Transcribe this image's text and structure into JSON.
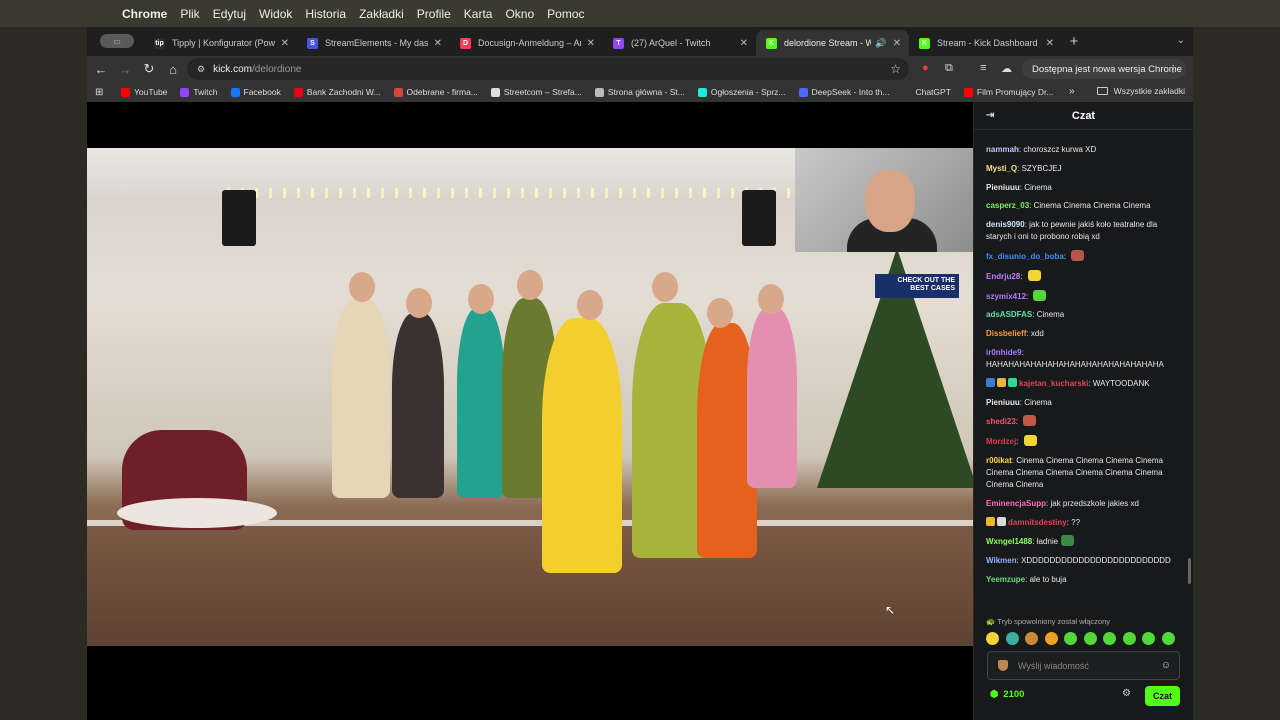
{
  "menubar": {
    "apple_icon": "apple-icon",
    "app": "Chrome",
    "items": [
      "Plik",
      "Edytuj",
      "Widok",
      "Historia",
      "Zakładki",
      "Profile",
      "Karta",
      "Okno",
      "Pomoc"
    ]
  },
  "tabs": [
    {
      "title": "Tipply | Konfigurator (Powiad",
      "active": false,
      "color": "#2a2a2a",
      "glyph": "tip"
    },
    {
      "title": "StreamElements - My dashbo",
      "active": false,
      "color": "#4a56e2",
      "glyph": "S"
    },
    {
      "title": "Docusign-Anmeldung – Anm",
      "active": false,
      "color": "#ff3b57",
      "glyph": "D"
    },
    {
      "title": "(27) ArQuel - Twitch",
      "active": false,
      "color": "#9146ff",
      "glyph": "T"
    },
    {
      "title": "delordione Stream - Watc",
      "active": true,
      "color": "#53fc18",
      "glyph": "K"
    },
    {
      "title": "Stream - Kick Dashboard",
      "active": false,
      "color": "#53fc18",
      "glyph": "K"
    }
  ],
  "toolbar": {
    "url_host": "kick.com",
    "url_path": "/delordione",
    "update_label": "Dostępna jest nowa wersja Chrome"
  },
  "bookmarks": {
    "items": [
      {
        "label": "YouTube",
        "color": "#ff0000"
      },
      {
        "label": "Twitch",
        "color": "#9146ff"
      },
      {
        "label": "Facebook",
        "color": "#1877f2"
      },
      {
        "label": "Bank Zachodni W...",
        "color": "#e30613"
      },
      {
        "label": "Odebrane - firma...",
        "color": "#d44638"
      },
      {
        "label": "Streetcom – Strefa...",
        "color": "#dddddd"
      },
      {
        "label": "Strona główna - St...",
        "color": "#bbbbbb"
      },
      {
        "label": "Ogłoszenia - Sprz...",
        "color": "#23e5db"
      },
      {
        "label": "DeepSeek - Into th...",
        "color": "#4d6bfe"
      },
      {
        "label": "ChatGPT",
        "color": "#333333"
      },
      {
        "label": "Film Promujący Dr...",
        "color": "#ff0000"
      }
    ],
    "more": "»",
    "all": "Wszystkie zakładki"
  },
  "video": {
    "ad_text": "CHECK OUT THE BEST CASES"
  },
  "chat": {
    "title": "Czat",
    "messages": [
      {
        "user": "nammah",
        "color": "#b9c9ff",
        "text": "choroszcz kurwa XD"
      },
      {
        "user": "Mysti_Q",
        "color": "#f5e08a",
        "text": "SZYBCJEJ"
      },
      {
        "user": "Pieniuuu",
        "color": "#e8e8e8",
        "text": "Cinema"
      },
      {
        "user": "casperz_03",
        "color": "#7bf05a",
        "text": "Cinema Cinema Cinema Cinema"
      },
      {
        "user": "denis9090",
        "color": "#cfe7ff",
        "text": "jak to pewnie jakiś koło teatralne dla starych i oni to probono robią xd"
      },
      {
        "user": "fx_disunio_do_boba",
        "color": "#3f8cff",
        "text": "",
        "emote": "#b5564a"
      },
      {
        "user": "Endrju28",
        "color": "#c27cff",
        "text": "",
        "emote": "#f0d43a"
      },
      {
        "user": "szymix412",
        "color": "#b07cff",
        "text": "",
        "emote": "#53d83a"
      },
      {
        "user": "adsASDFAS",
        "color": "#62e0b2",
        "text": "Cinema"
      },
      {
        "user": "Dissbelieff",
        "color": "#ff9a3d",
        "text": "xdd"
      },
      {
        "user": "ir0nhide9",
        "color": "#a77bff",
        "text": "HAHAHAHAHAHAHAHAHAHAHAHAHAHAHAHA"
      },
      {
        "user": "kajetan_kucharski",
        "color": "#e0425c",
        "text": "WAYTOODANK",
        "badges": [
          "#3b7bd9",
          "#e7b63a",
          "#2dd89a"
        ]
      },
      {
        "user": "Pieniuuu",
        "color": "#e8e8e8",
        "text": "Cinema"
      },
      {
        "user": "shedi23",
        "color": "#ff4d6a",
        "text": "",
        "emote": "#c35a47"
      },
      {
        "user": "Mordzej",
        "color": "#e03a52",
        "text": "",
        "emote": "#f0d43a"
      },
      {
        "user": "r00ikat",
        "color": "#ffd84d",
        "text": "Cinema Cinema Cinema Cinema Cinema Cinema Cinema Cinema Cinema Cinema Cinema Cinema Cinema"
      },
      {
        "user": "EminencjaSupp",
        "color": "#ff6fb3",
        "text": "jak przedszkole jakies xd"
      },
      {
        "user": "damnitsdestiny",
        "color": "#e0425c",
        "text": "??",
        "badges": [
          "#f0b52a",
          "#d9d9d9"
        ]
      },
      {
        "user": "Wxngel1488",
        "color": "#8dff5a",
        "text": "ładnie",
        "emote": "#3b8a4a"
      },
      {
        "user": "Wikmen",
        "color": "#8ab4ff",
        "text": "XDDDDDDDDDDDDDDDDDDDDDDDDD"
      },
      {
        "user": "Yeemzupe",
        "color": "#62e07b",
        "text": "ale to buja"
      }
    ],
    "slow_mode": "Tryb spowolniony został włączony",
    "emote_bar_colors": [
      "#f0d43a",
      "#3ab0a0",
      "#c98a3a",
      "#f0a020",
      "#53d83a",
      "#53d83a",
      "#53d83a",
      "#53d83a",
      "#53d83a",
      "#53d83a"
    ],
    "input_placeholder": "Wyślij wiadomość",
    "points": "2100",
    "send_label": "Czat"
  }
}
